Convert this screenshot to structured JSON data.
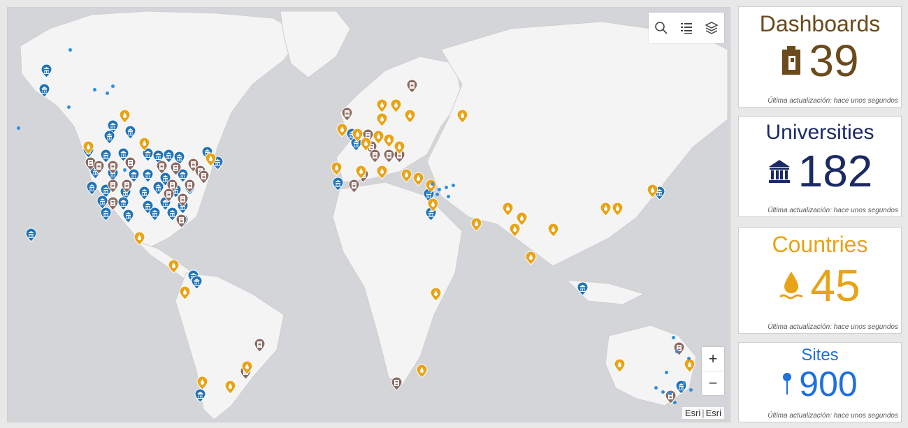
{
  "map": {
    "attribution": [
      "Esri",
      "Esri"
    ],
    "zoom_in": "+",
    "zoom_out": "−",
    "colors": {
      "land": "#f4f4f4",
      "water": "#d4d5d8",
      "university": "#1f73b7",
      "dashboard": "#8c6a61",
      "country": "#e8a317",
      "site": "#2f8fde"
    },
    "toolbar_icons": [
      "search-icon",
      "legend-list-icon",
      "layers-icon"
    ]
  },
  "indicators": [
    {
      "key": "dashboards",
      "title": "Dashboards",
      "value": "39",
      "updated": "Última actualización: hace unos segundos",
      "color": "#6b4a1c",
      "icon": "clipboard-icon"
    },
    {
      "key": "universities",
      "title": "Universities",
      "value": "182",
      "updated": "Última actualización: hace unos segundos",
      "color": "#1b2a63",
      "icon": "university-icon"
    },
    {
      "key": "countries",
      "title": "Countries",
      "value": "45",
      "updated": "Última actualización: hace unos segundos",
      "color": "#e8a317",
      "icon": "water-drop-icon"
    },
    {
      "key": "sites",
      "title": "Sites",
      "value": "900",
      "updated": "Última actualización: hace unos segundos",
      "color": "#1e6fe0",
      "icon": "pin-icon"
    }
  ]
}
